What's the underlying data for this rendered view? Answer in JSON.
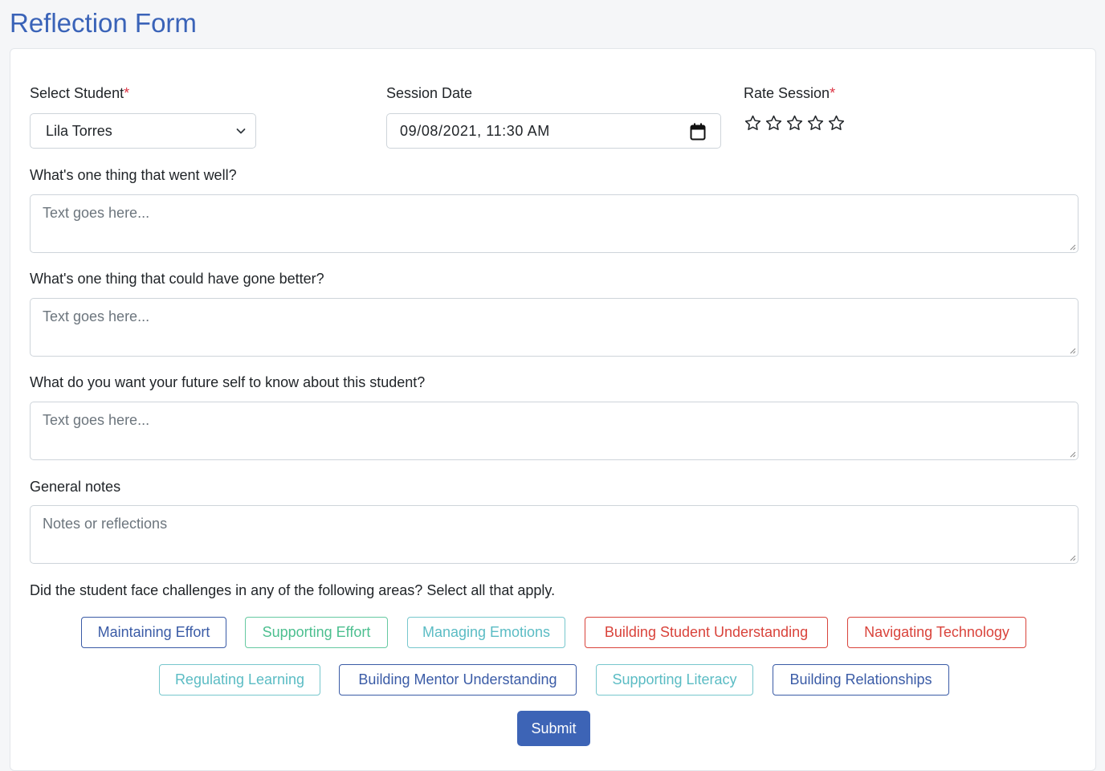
{
  "page": {
    "title": "Reflection Form"
  },
  "form": {
    "student": {
      "label": "Select Student",
      "required_mark": "*",
      "value": "Lila Torres"
    },
    "session_date": {
      "label": "Session Date",
      "value": "09/08/2021, 11:30 AM"
    },
    "rating": {
      "label": "Rate Session",
      "required_mark": "*",
      "max_stars": 5,
      "value": 0
    },
    "went_well": {
      "label": "What's one thing that went well?",
      "placeholder": "Text goes here..."
    },
    "could_be_better": {
      "label": "What's one thing that could have gone better?",
      "placeholder": "Text goes here..."
    },
    "future_self": {
      "label": "What do you want your future self to know about this student?",
      "placeholder": "Text goes here..."
    },
    "general_notes": {
      "label": "General notes",
      "placeholder": "Notes or reflections"
    },
    "challenges": {
      "prompt": "Did the student face challenges in any of the following areas? Select all that apply.",
      "tags": [
        {
          "label": "Maintaining Effort",
          "color": "#3a5ba6"
        },
        {
          "label": "Supporting Effort",
          "color": "#4cbf8f"
        },
        {
          "label": "Managing Emotions",
          "color": "#5bbcc4"
        },
        {
          "label": "Building Student Understanding",
          "color": "#d9433b"
        },
        {
          "label": "Navigating Technology",
          "color": "#d9433b"
        },
        {
          "label": "Regulating Learning",
          "color": "#5bbcc4"
        },
        {
          "label": "Building Mentor Understanding",
          "color": "#3a5ba6"
        },
        {
          "label": "Supporting Literacy",
          "color": "#5bbcc4"
        },
        {
          "label": "Building Relationships",
          "color": "#3a5ba6"
        }
      ]
    },
    "submit_label": "Submit"
  },
  "icons": {
    "select": "chevron-down-icon",
    "date": "calendar-icon",
    "rating": "star-outline-icon",
    "textarea": "resize-grip-icon"
  },
  "colors": {
    "title": "#3a63b8",
    "primary_button": "#3d64b6",
    "required": "#dc3545"
  }
}
